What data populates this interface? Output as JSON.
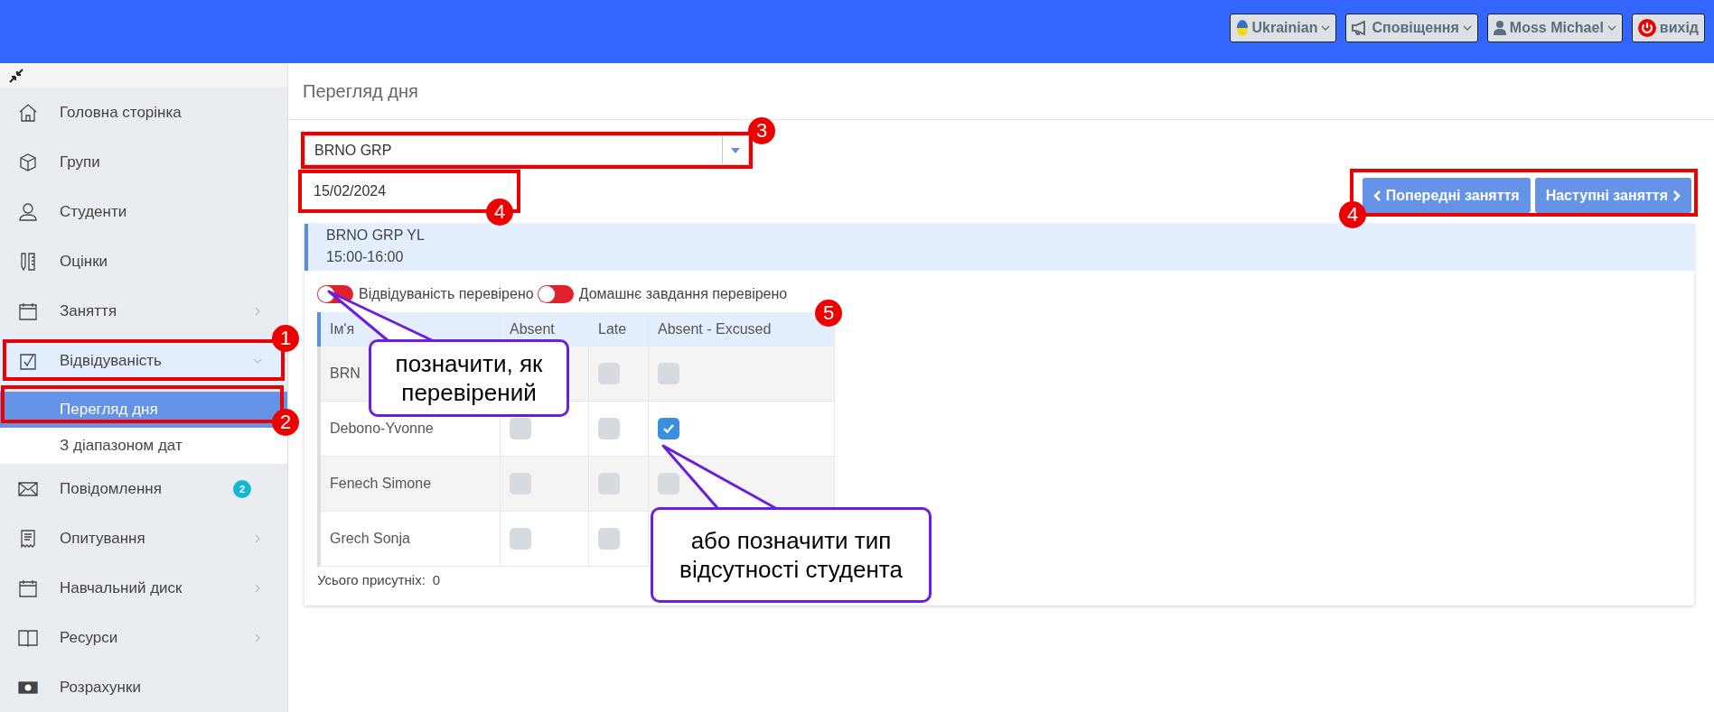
{
  "top_bar": {
    "items": [
      {
        "kind": "language",
        "label": "Ukrainian"
      },
      {
        "kind": "notifications",
        "label": "Сповіщення"
      },
      {
        "kind": "user",
        "label": "Moss Michael"
      },
      {
        "kind": "logout",
        "label": "вихід"
      }
    ]
  },
  "sidebar": {
    "items": [
      {
        "label": "Головна сторінка",
        "selected": false
      },
      {
        "label": "Групи",
        "selected": false
      },
      {
        "label": "Студенти",
        "selected": false
      },
      {
        "label": "Оцінки",
        "selected": false
      },
      {
        "label": "Заняття",
        "selected": false,
        "expanded": false
      },
      {
        "label": "Відвідуваність",
        "selected": true,
        "expanded": true,
        "children": [
          {
            "label": "Перегляд дня",
            "selected": true
          },
          {
            "label": "З діапазоном дат",
            "selected": false
          }
        ]
      },
      {
        "label": "Повідомлення",
        "selected": false,
        "badge": "2"
      },
      {
        "label": "Опитування",
        "selected": false,
        "expanded": false
      },
      {
        "label": "Навчальний диск",
        "selected": false,
        "expanded": false
      },
      {
        "label": "Ресурси",
        "selected": false,
        "expanded": false
      },
      {
        "label": "Розрахунки",
        "selected": false
      }
    ]
  },
  "page": {
    "title": "Перегляд дня",
    "group_select": {
      "value": "BRNO GRP"
    },
    "date_field": {
      "value": "15/02/2024"
    },
    "nav_buttons": [
      "Попередні заняття",
      "Наступні заняття"
    ],
    "lesson": {
      "name": "BRNO GRP YL",
      "time": "15:00-16:00"
    },
    "toggles": [
      {
        "label": "Відвідуваність перевірено",
        "on": false
      },
      {
        "label": "Домашнє завдання перевірено",
        "on": false
      }
    ],
    "table": {
      "columns": [
        "Ім'я",
        "Absent",
        "Late",
        "Absent - Excused"
      ],
      "rows": [
        {
          "name": "BRN",
          "late": false,
          "excused": false
        },
        {
          "name": "Debono-Yvonne",
          "absent": false,
          "late": false,
          "excused": true
        },
        {
          "name": "Fenech Simone",
          "absent": false,
          "late": false,
          "excused": false
        },
        {
          "name": "Grech Sonja",
          "absent": false,
          "late": false
        }
      ]
    },
    "total": {
      "label": "Усього присутніх:",
      "value": "0"
    }
  },
  "annotations": {
    "markers": [
      "1",
      "2",
      "3",
      "4",
      "4",
      "5"
    ],
    "callouts": [
      "позначити, як перевірений",
      "або позначити тип відсутності студента"
    ]
  }
}
